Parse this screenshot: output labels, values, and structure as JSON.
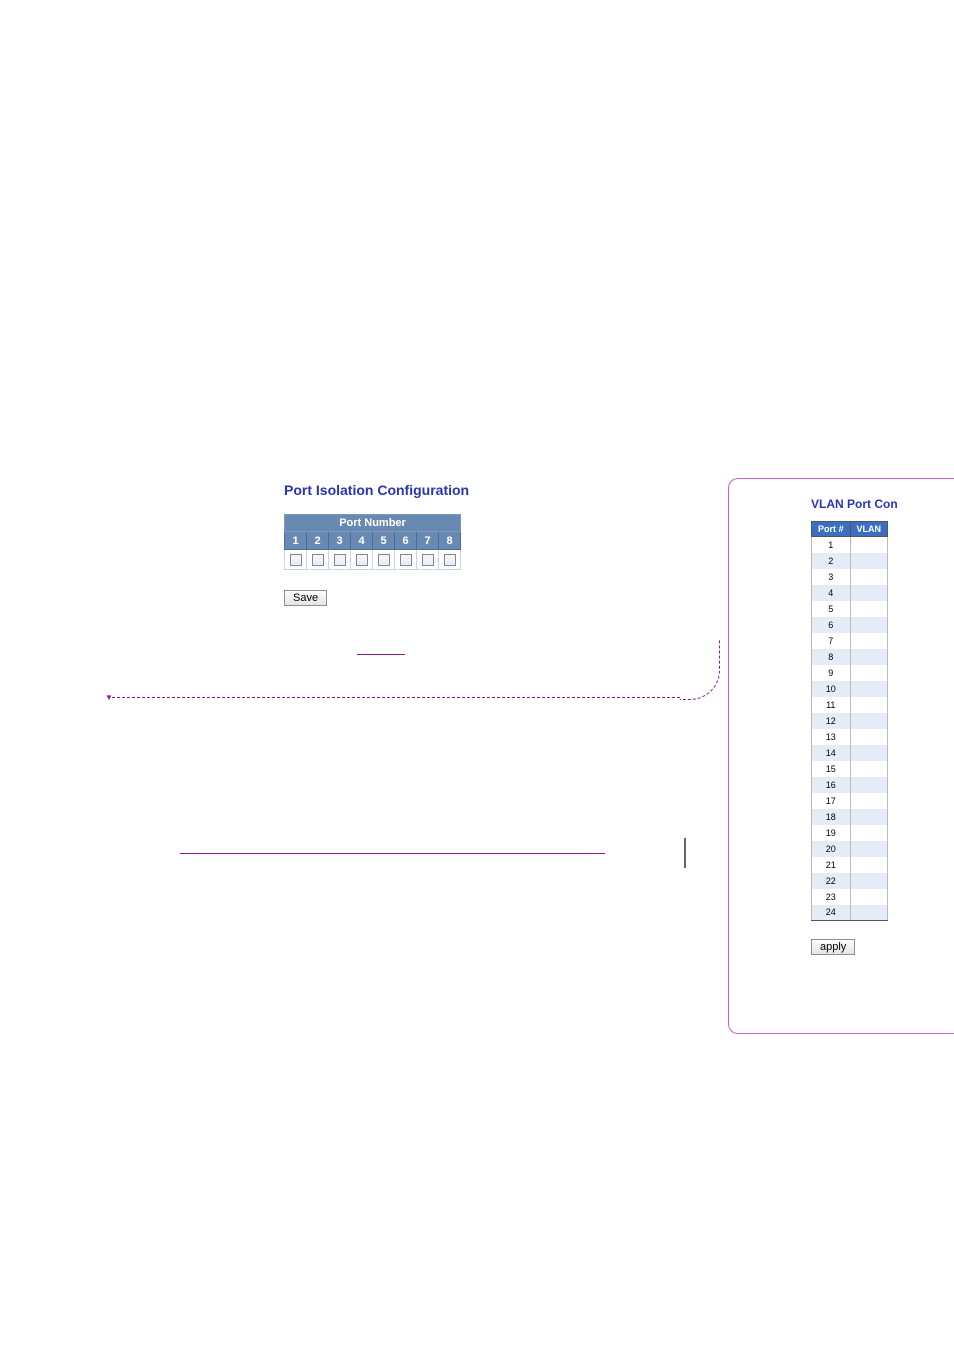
{
  "port_isolation": {
    "title": "Port Isolation Configuration",
    "header": "Port Number",
    "ports": [
      "1",
      "2",
      "3",
      "4",
      "5",
      "6",
      "7",
      "8"
    ],
    "save_label": "Save"
  },
  "vlan_port": {
    "title": "VLAN Port Con",
    "col_port": "Port #",
    "col_vlan": "VLAN",
    "rows": [
      "1",
      "2",
      "3",
      "4",
      "5",
      "6",
      "7",
      "8",
      "9",
      "10",
      "11",
      "12",
      "13",
      "14",
      "15",
      "16",
      "17",
      "18",
      "19",
      "20",
      "21",
      "22",
      "23",
      "24"
    ],
    "apply_label": "apply"
  }
}
